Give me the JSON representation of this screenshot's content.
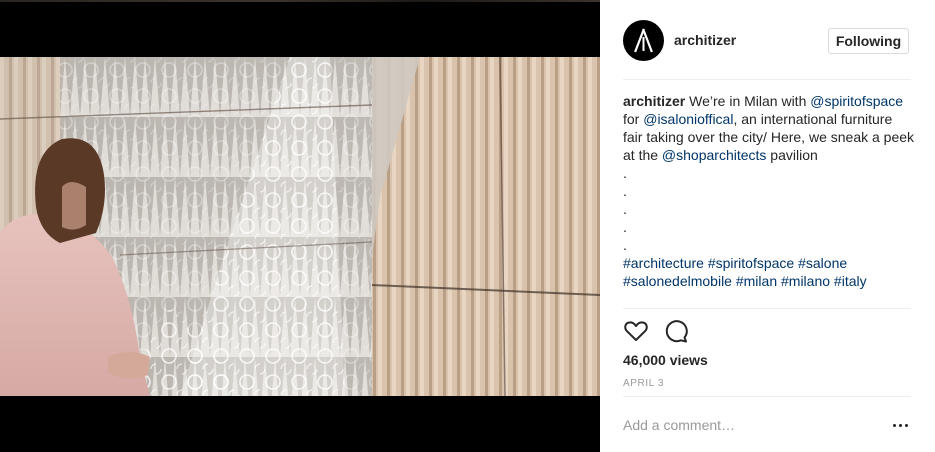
{
  "media": {
    "type": "video",
    "alt": "Woman in pink blouse examining a lace-patterned curtain installation"
  },
  "post": {
    "author": "architizer",
    "follow_label": "Following",
    "caption": {
      "author": "architizer",
      "segments": [
        {
          "text": " We’re in Milan with ",
          "link": false
        },
        {
          "text": "@spiritofspace",
          "link": true
        },
        {
          "text": " for ",
          "link": false
        },
        {
          "text": "@isalonioffical",
          "link": true
        },
        {
          "text": ", an international furniture fair taking over the city/ Here, we sneak a peek at the ",
          "link": false
        },
        {
          "text": "@shoparchitects",
          "link": true
        },
        {
          "text": " pavilion",
          "link": false
        }
      ],
      "dots": [
        ".",
        ".",
        ".",
        ".",
        "."
      ],
      "hashtags": [
        "#architecture",
        "#spiritofspace",
        "#salone",
        "#salonedelmobile",
        "#milan",
        "#milano",
        "#italy"
      ]
    },
    "views": "46,000 views",
    "date": "APRIL 3",
    "comment_placeholder": "Add a comment…"
  },
  "icons": {
    "avatar": "architizer-logo-icon",
    "like": "heart-icon",
    "comment": "comment-bubble-icon",
    "more": "more-options-icon"
  },
  "colors": {
    "link": "#003569",
    "text": "#262626",
    "muted": "#999999",
    "border": "#dbdbdb"
  }
}
